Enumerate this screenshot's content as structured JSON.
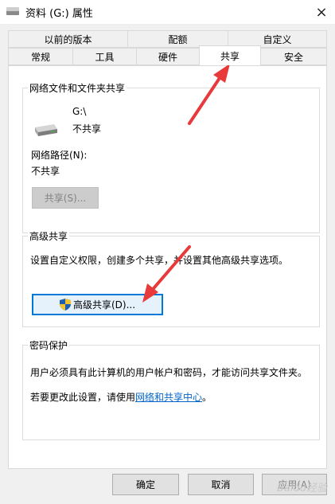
{
  "window": {
    "title": "资料 (G:) 属性",
    "close_icon": "×"
  },
  "tabs": {
    "row1": [
      "以前的版本",
      "配额",
      "自定义"
    ],
    "row2": [
      "常规",
      "工具",
      "硬件",
      "共享",
      "安全"
    ],
    "active": "共享"
  },
  "network_share": {
    "group_title": "网络文件和文件夹共享",
    "drive_label": "G:\\",
    "drive_status": "不共享",
    "path_label": "网络路径(N):",
    "path_value": "不共享",
    "share_button": "共享(S)..."
  },
  "advanced_share": {
    "group_title": "高级共享",
    "description": "设置自定义权限，创建多个共享，并设置其他高级共享选项。",
    "button": "高级共享(D)..."
  },
  "password_protection": {
    "group_title": "密码保护",
    "description": "用户必须具有此计算机的用户帐户和密码，才能访问共享文件夹。",
    "change_text": "若要更改此设置，请使用",
    "link_text": "网络和共享中心",
    "change_suffix": "。"
  },
  "footer": {
    "ok": "确定",
    "cancel": "取消",
    "apply": "应用(A)"
  },
  "watermark": "Baidu经验",
  "colors": {
    "accent": "#0078d7",
    "link": "#0066cc",
    "arrow": "#e83a3a"
  }
}
